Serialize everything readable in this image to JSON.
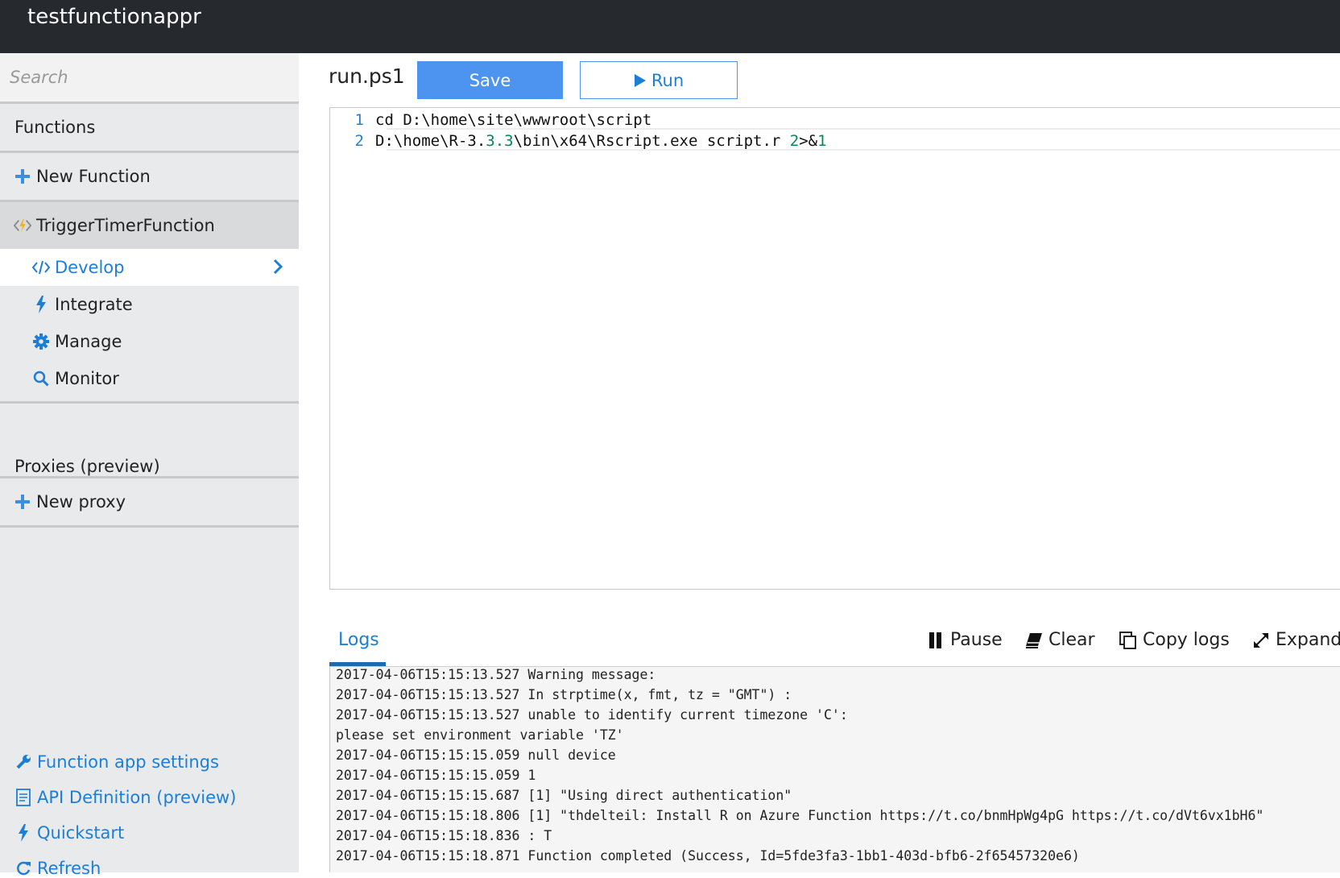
{
  "app": {
    "title": "testfunctionappr"
  },
  "sidebar": {
    "search_placeholder": "Search",
    "functions_label": "Functions",
    "new_function_label": "New Function",
    "function_name": "TriggerTimerFunction",
    "sub_items": [
      {
        "label": "Develop",
        "icon": "code-icon",
        "selected": true
      },
      {
        "label": "Integrate",
        "icon": "lightning-icon"
      },
      {
        "label": "Manage",
        "icon": "gear-icon"
      },
      {
        "label": "Monitor",
        "icon": "search-icon"
      }
    ],
    "proxies_label": "Proxies (preview)",
    "new_proxy_label": "New proxy",
    "footer_links": [
      {
        "label": "Function app settings",
        "icon": "wrench-icon"
      },
      {
        "label": "API Definition (preview)",
        "icon": "document-icon"
      },
      {
        "label": "Quickstart",
        "icon": "lightning-icon"
      },
      {
        "label": "Refresh",
        "icon": "refresh-icon"
      }
    ]
  },
  "editor": {
    "filename": "run.ps1",
    "save_label": "Save",
    "run_label": "Run",
    "lines": [
      {
        "number": "1",
        "segments": [
          {
            "text": "cd D:\\home\\site\\wwwroot\\script",
            "kind": "text"
          }
        ]
      },
      {
        "number": "2",
        "segments": [
          {
            "text": "D:\\home\\R-3.",
            "kind": "text"
          },
          {
            "text": "3.3",
            "kind": "num"
          },
          {
            "text": "\\bin\\x64\\Rscript.exe script.r ",
            "kind": "text"
          },
          {
            "text": "2",
            "kind": "num"
          },
          {
            "text": ">&",
            "kind": "text"
          },
          {
            "text": "1",
            "kind": "num"
          }
        ]
      }
    ]
  },
  "logs": {
    "tab_label": "Logs",
    "actions": {
      "pause": "Pause",
      "clear": "Clear",
      "copy": "Copy logs",
      "expand": "Expand"
    },
    "lines": [
      "2017-04-06T15:15:13.527 Warning message:",
      "2017-04-06T15:15:13.527 In strptime(x, fmt, tz = \"GMT\") :",
      "2017-04-06T15:15:13.527 unable to identify current timezone 'C':",
      "please set environment variable 'TZ'",
      "2017-04-06T15:15:15.059 null device",
      "2017-04-06T15:15:15.059 1",
      "2017-04-06T15:15:15.687 [1] \"Using direct authentication\"",
      "2017-04-06T15:15:18.806 [1] \"thdelteil: Install R on Azure Function https://t.co/bnmHpWg4pG https://t.co/dVt6vx1bH6\"",
      "2017-04-06T15:15:18.836 : T",
      "2017-04-06T15:15:18.871 Function completed (Success, Id=5fde3fa3-1bb1-403d-bfb6-2f65457320e6)"
    ]
  },
  "colors": {
    "accent": "#1d7ed8",
    "save_button": "#4d94f0",
    "topbar": "#262a2f",
    "sidebar": "#e9eaec"
  }
}
